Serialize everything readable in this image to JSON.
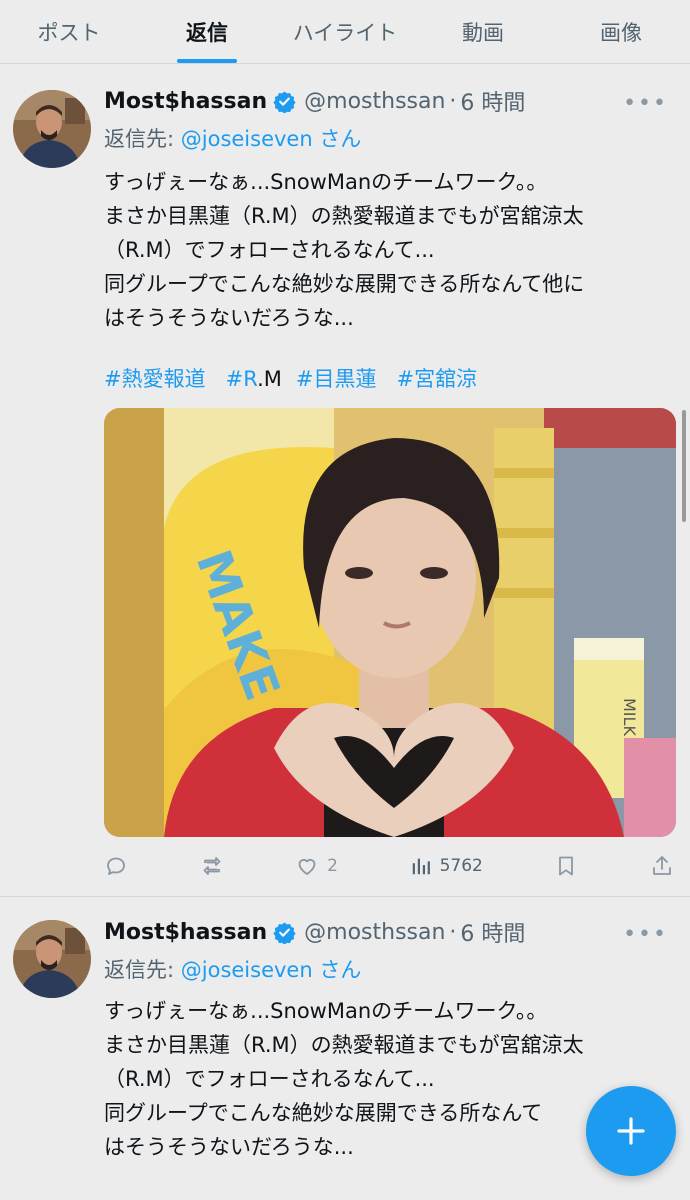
{
  "tabs": [
    {
      "label": "ポスト"
    },
    {
      "label": "返信",
      "active": true
    },
    {
      "label": "ハイライト"
    },
    {
      "label": "動画"
    },
    {
      "label": "画像"
    }
  ],
  "tweets": [
    {
      "display_name": "Most$hassan",
      "handle": "@mosthssan",
      "separator": "·",
      "time": "6 時間",
      "reply_prefix": "返信先: ",
      "reply_mention": "@joseiseven",
      "reply_suffix": " さん",
      "text_lines": [
        "すっげぇーなぁ...SnowManのチームワーク。。",
        "まさか目黒蓮（R.M）の熱愛報道までもが宮舘涼太",
        "（R.M）でフォローされるなんて...",
        "同グループでこんな絶妙な展開できる所なんて他に",
        "はそうそうないだろうな..."
      ],
      "hashtags": [
        "#熱愛報道",
        "#R",
        "#目黒蓮",
        "#宮舘涼"
      ],
      "hashtag_plain": ".M",
      "stats": {
        "replies": "",
        "reposts": "",
        "likes": "2",
        "views": "5762"
      }
    },
    {
      "display_name": "Most$hassan",
      "handle": "@mosthssan",
      "separator": "·",
      "time": "6 時間",
      "reply_prefix": "返信先: ",
      "reply_mention": "@joseiseven",
      "reply_suffix": " さん",
      "text_lines": [
        "すっげぇーなぁ...SnowManのチームワーク。。",
        "まさか目黒蓮（R.M）の熱愛報道までもが宮舘涼太",
        "（R.M）でフォローされるなんて...",
        "同グループでこんな絶妙な展開できる所なんて",
        "はそうそうないだろうな..."
      ]
    }
  ],
  "media": {
    "sign_letters": "MAKE",
    "milk_label": "MILK",
    "more_icon": "more-dots-icon"
  },
  "colors": {
    "accent": "#1d9bf0",
    "background": "#ececec",
    "text": "#0f1419",
    "muted": "#536471"
  }
}
